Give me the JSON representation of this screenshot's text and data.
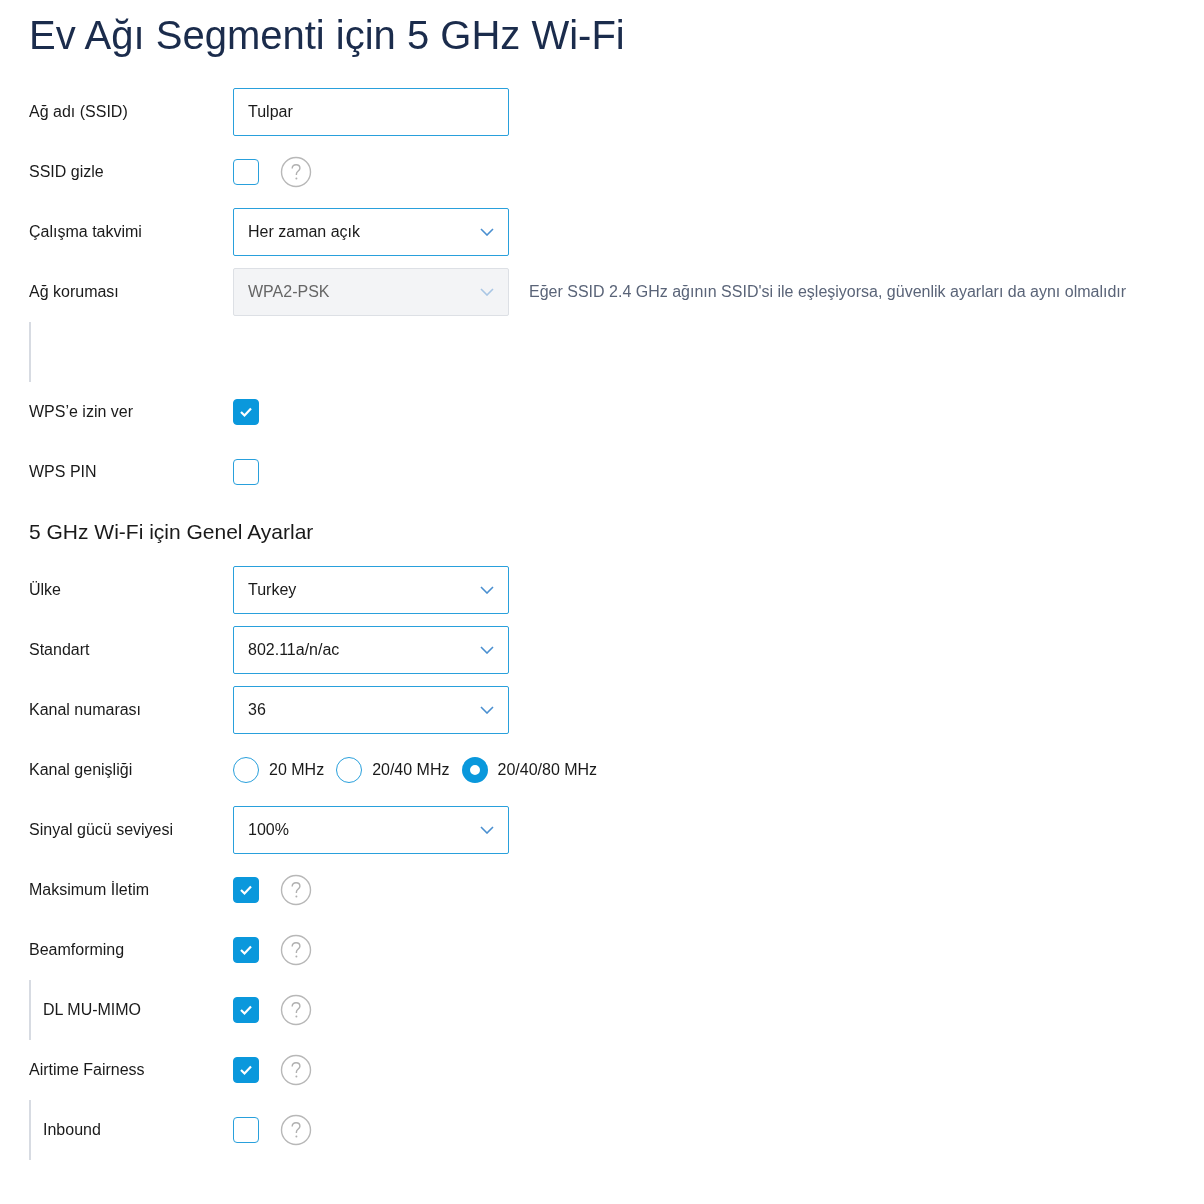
{
  "sections": [
    {
      "title": "Ev Ağı Segmenti için 5 GHz Wi-Fi",
      "rows": [
        {
          "kind": "text",
          "label": "Ağ adı (SSID)",
          "value": "Tulpar",
          "indented": false
        },
        {
          "kind": "checkbox",
          "label": "SSID gizle",
          "checked": false,
          "help": true,
          "indented": false
        },
        {
          "kind": "select",
          "label": "Çalışma takvimi",
          "value": "Her zaman açık",
          "disabled": false,
          "indented": false
        },
        {
          "kind": "select",
          "label": "Ağ koruması",
          "value": "WPA2-PSK",
          "disabled": true,
          "note": "Eğer SSID 2.4 GHz ağının SSID'si ile eşleşiyorsa, güvenlik ayarları da aynı olmalıdır",
          "indented": false
        },
        {
          "kind": "spacer",
          "indented": true
        },
        {
          "kind": "checkbox",
          "label": "WPS’e izin ver",
          "checked": true,
          "help": false,
          "indented": false
        },
        {
          "kind": "checkbox",
          "label": "WPS PIN",
          "checked": false,
          "help": false,
          "indented": false
        }
      ]
    },
    {
      "title": "5 GHz Wi-Fi için Genel Ayarlar",
      "rows": [
        {
          "kind": "select",
          "label": "Ülke",
          "value": "Turkey",
          "disabled": false,
          "indented": false
        },
        {
          "kind": "select",
          "label": "Standart",
          "value": "802.11a/n/ac",
          "disabled": false,
          "indented": false
        },
        {
          "kind": "select",
          "label": "Kanal numarası",
          "value": "36",
          "disabled": false,
          "indented": false
        },
        {
          "kind": "radio",
          "label": "Kanal genişliği",
          "options": [
            {
              "label": "20 MHz",
              "selected": false
            },
            {
              "label": "20/40 MHz",
              "selected": false
            },
            {
              "label": "20/40/80 MHz",
              "selected": true
            }
          ],
          "indented": false
        },
        {
          "kind": "select",
          "label": "Sinyal gücü seviyesi",
          "value": "100%",
          "disabled": false,
          "indented": false
        },
        {
          "kind": "checkbox",
          "label": "Maksimum İletim",
          "checked": true,
          "help": true,
          "indented": false
        },
        {
          "kind": "checkbox",
          "label": "Beamforming",
          "checked": true,
          "help": true,
          "indented": false
        },
        {
          "kind": "checkbox",
          "label": "DL MU-MIMO",
          "checked": true,
          "help": true,
          "indented": true
        },
        {
          "kind": "checkbox",
          "label": "Airtime Fairness",
          "checked": true,
          "help": true,
          "indented": false
        },
        {
          "kind": "checkbox",
          "label": "Inbound",
          "checked": false,
          "help": true,
          "indented": true
        }
      ]
    }
  ]
}
